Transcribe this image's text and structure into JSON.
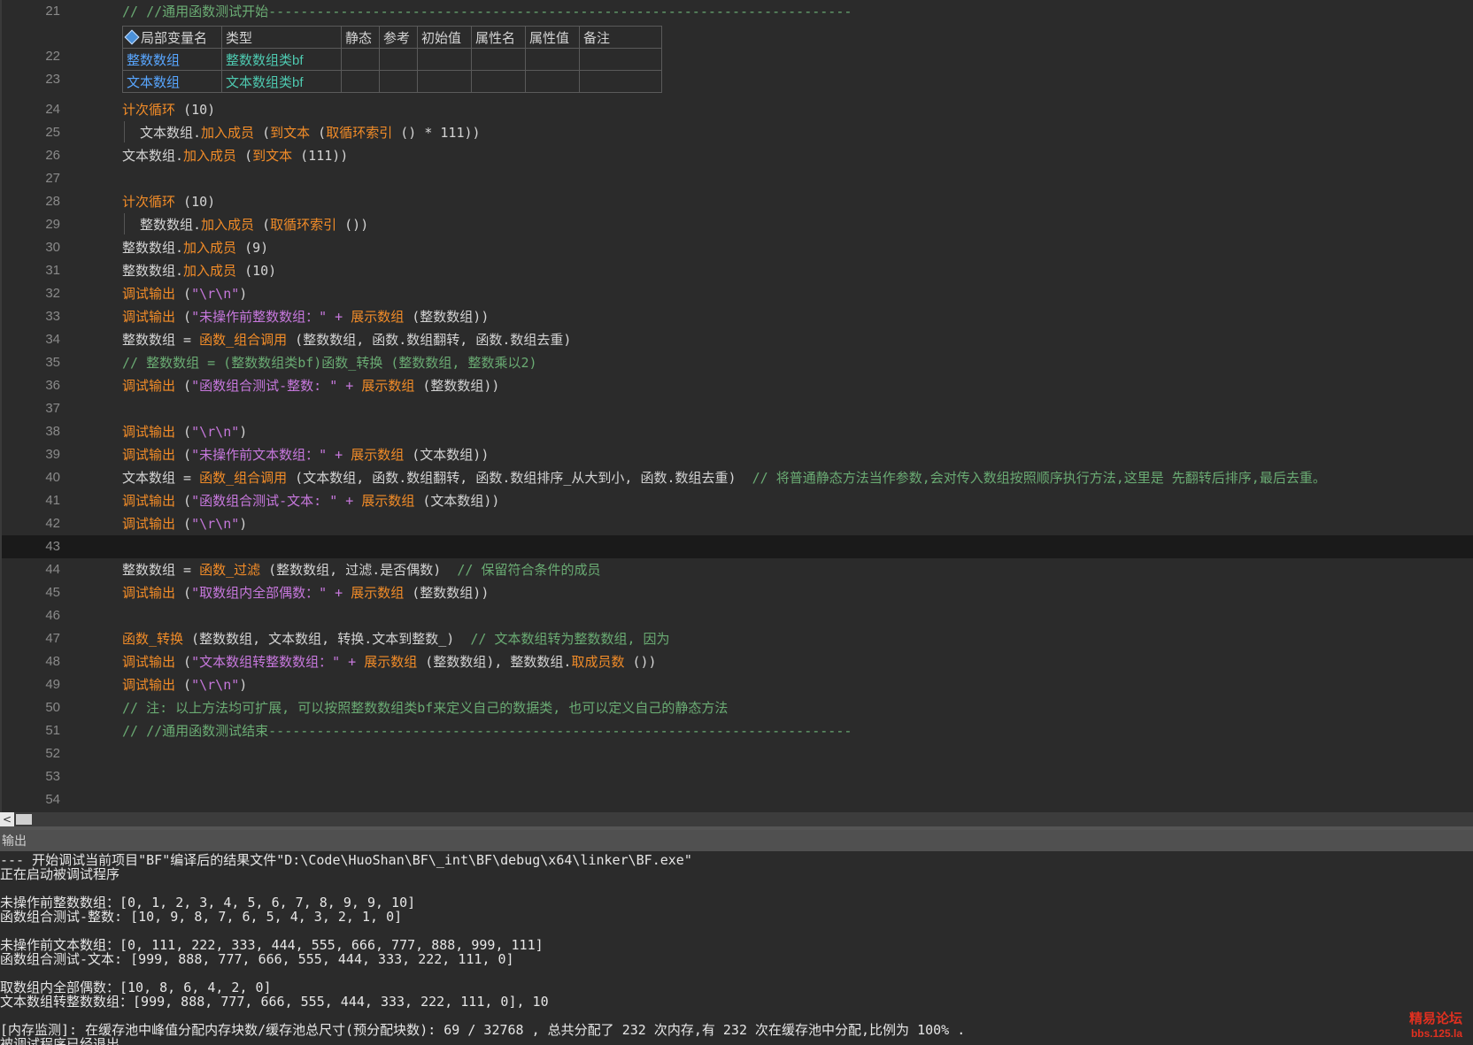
{
  "editor": {
    "line_numbers": [
      "21",
      "22",
      "23",
      "24",
      "25",
      "26",
      "27",
      "28",
      "29",
      "30",
      "31",
      "32",
      "33",
      "34",
      "35",
      "36",
      "37",
      "38",
      "39",
      "40",
      "41",
      "42",
      "43",
      "44",
      "45",
      "46",
      "47",
      "48",
      "49",
      "50",
      "51",
      "52",
      "53",
      "54"
    ],
    "l21": {
      "a": "// //通用函数测试开始",
      "b": "-------------------------------------------------------------------------"
    },
    "var_table": {
      "headers": [
        "局部变量名",
        "类型",
        "静态",
        "参考",
        "初始值",
        "属性名",
        "属性值",
        "备注"
      ],
      "rows": [
        [
          "整数数组",
          "整数数组类bf"
        ],
        [
          "文本数组",
          "文本数组类bf"
        ]
      ]
    },
    "l24": {
      "a": "计次循环",
      "b": " (10)"
    },
    "l25": {
      "a": "文本数组.",
      "b": "加入成员",
      "c": " (",
      "d": "到文本",
      "e": " (",
      "f": "取循环索引",
      "g": " () * 111))"
    },
    "l26": {
      "a": "文本数组.",
      "b": "加入成员",
      "c": " (",
      "d": "到文本",
      "e": " (111))"
    },
    "l28": {
      "a": "计次循环",
      "b": " (10)"
    },
    "l29": {
      "a": "整数数组.",
      "b": "加入成员",
      "c": " (",
      "d": "取循环索引",
      "e": " ())"
    },
    "l30": {
      "a": "整数数组.",
      "b": "加入成员",
      "c": " (9)"
    },
    "l31": {
      "a": "整数数组.",
      "b": "加入成员",
      "c": " (10)"
    },
    "l32": {
      "a": "调试输出",
      "b": " (",
      "c": "\"\\r\\n\"",
      "d": ")"
    },
    "l33": {
      "a": "调试输出",
      "b": " (",
      "c": "\"未操作前整数数组：\"",
      "d": " + ",
      "e": "展示数组",
      "f": " (整数数组))"
    },
    "l34": {
      "a": "整数数组 = ",
      "b": "函数_组合调用",
      "c": " (整数数组, 函数.数组翻转, 函数.数组去重)"
    },
    "l35": {
      "a": "// 整数数组 = (整数数组类bf)函数_转换 (整数数组, 整数乘以2)"
    },
    "l36": {
      "a": "调试输出",
      "b": " (",
      "c": "\"函数组合测试-整数: \"",
      "d": " + ",
      "e": "展示数组",
      "f": " (整数数组))"
    },
    "l38": {
      "a": "调试输出",
      "b": " (",
      "c": "\"\\r\\n\"",
      "d": ")"
    },
    "l39": {
      "a": "调试输出",
      "b": " (",
      "c": "\"未操作前文本数组：\"",
      "d": " + ",
      "e": "展示数组",
      "f": " (文本数组))"
    },
    "l40": {
      "a": "文本数组 = ",
      "b": "函数_组合调用",
      "c": " (文本数组, 函数.数组翻转, 函数.数组排序_从大到小, 函数.数组去重)  ",
      "d": "// 将普通静态方法当作参数,会对传入数组按照顺序执行方法,这里是 先翻转后排序,最后去重。"
    },
    "l41": {
      "a": "调试输出",
      "b": " (",
      "c": "\"函数组合测试-文本: \"",
      "d": " + ",
      "e": "展示数组",
      "f": " (文本数组))"
    },
    "l42": {
      "a": "调试输出",
      "b": " (",
      "c": "\"\\r\\n\"",
      "d": ")"
    },
    "l44": {
      "a": "整数数组 = ",
      "b": "函数_过滤",
      "c": " (整数数组, 过滤.是否偶数)  ",
      "d": "// 保留符合条件的成员"
    },
    "l45": {
      "a": "调试输出",
      "b": " (",
      "c": "\"取数组内全部偶数：\"",
      "d": " + ",
      "e": "展示数组",
      "f": " (整数数组))"
    },
    "l47": {
      "a": "函数_转换",
      "b": " (整数数组, 文本数组, 转换.文本到整数_)  ",
      "c": "// 文本数组转为整数数组, 因为"
    },
    "l48": {
      "a": "调试输出",
      "b": " (",
      "c": "\"文本数组转整数数组：\"",
      "d": " + ",
      "e": "展示数组",
      "f": " (整数数组), 整数数组.",
      "g": "取成员数",
      "h": " ())"
    },
    "l49": {
      "a": "调试输出",
      "b": " (",
      "c": "\"\\r\\n\"",
      "d": ")"
    },
    "l50": {
      "a": "// 注: 以上方法均可扩展, 可以按照整数数组类bf来定义自己的数据类, 也可以定义自己的静态方法"
    },
    "l51": {
      "a": "// //通用函数测试结束",
      "b": "-------------------------------------------------------------------------"
    }
  },
  "scrollbar": {
    "left_arrow": "<"
  },
  "output": {
    "title": "输出",
    "lines": [
      "--- 开始调试当前项目\"BF\"编译后的结果文件\"D:\\Code\\HuoShan\\BF\\_int\\BF\\debug\\x64\\linker\\BF.exe\"",
      "正在启动被调试程序",
      "",
      "未操作前整数数组：[0, 1, 2, 3, 4, 5, 6, 7, 8, 9, 9, 10]",
      "函数组合测试-整数: [10, 9, 8, 7, 6, 5, 4, 3, 2, 1, 0]",
      "",
      "未操作前文本数组：[0, 111, 222, 333, 444, 555, 666, 777, 888, 999, 111]",
      "函数组合测试-文本: [999, 888, 777, 666, 555, 444, 333, 222, 111, 0]",
      "",
      "取数组内全部偶数：[10, 8, 6, 4, 2, 0]",
      "文本数组转整数数组：[999, 888, 777, 666, 555, 444, 333, 222, 111, 0], 10",
      "",
      "[内存监测]: 在缓存池中峰值分配内存块数/缓存池总尺寸(预分配块数): 69 / 32768 , 总共分配了 232 次内存,有 232 次在缓存池中分配,比例为 100% .",
      "被调试程序已经退出"
    ]
  },
  "watermark": {
    "line1": "精易论坛",
    "line2": "bbs.125.la"
  },
  "colors": {
    "keyword": "#f28c28",
    "string": "#c778dd",
    "comment": "#6aab73",
    "type": "#4ec9b0",
    "text": "#d4d4d4"
  }
}
